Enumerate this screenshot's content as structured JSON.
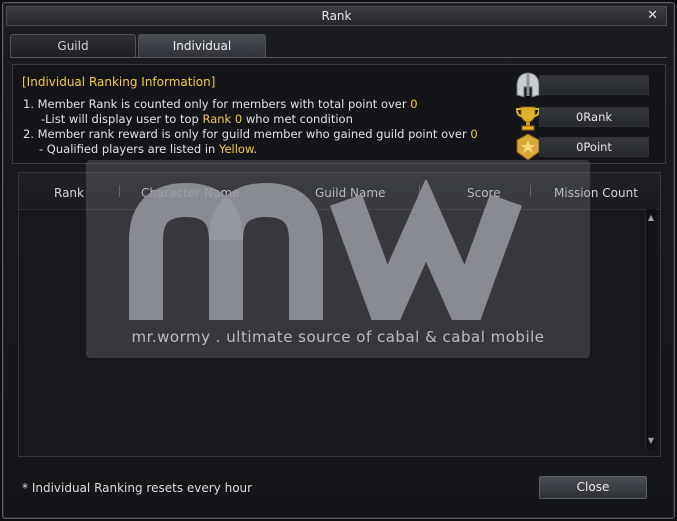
{
  "window": {
    "title": "Rank"
  },
  "tabs": [
    {
      "label": "Guild",
      "active": false
    },
    {
      "label": "Individual",
      "active": true
    }
  ],
  "info": {
    "heading": "[Individual Ranking Information]",
    "line1_prefix": "1. Member Rank is counted only for members with total point over ",
    "line1_value": "0",
    "line2_prefix": "-List will display user to top ",
    "line2_highlight": "Rank 0",
    "line2_suffix": " who met condition",
    "line3_prefix": "2. Member rank reward is only for guild member who gained guild point over ",
    "line3_value": "0",
    "line4_prefix": "- Qualified players are listed in ",
    "line4_highlight": "Yellow",
    "line4_suffix": "."
  },
  "stats": {
    "name_value": "",
    "rank_value": "0Rank",
    "point_value": "0Point"
  },
  "table": {
    "columns": [
      "Rank",
      "Character Name",
      "Guild Name",
      "Score",
      "Mission Count"
    ],
    "rows": []
  },
  "watermark": {
    "logo_text": "mw",
    "caption": "mr.wormy . ultimate source of cabal & cabal mobile"
  },
  "footer": {
    "note": "* Individual Ranking resets every hour",
    "close_label": "Close"
  },
  "colors": {
    "highlight": "#f2c94c",
    "panel_bg": "#141518"
  }
}
